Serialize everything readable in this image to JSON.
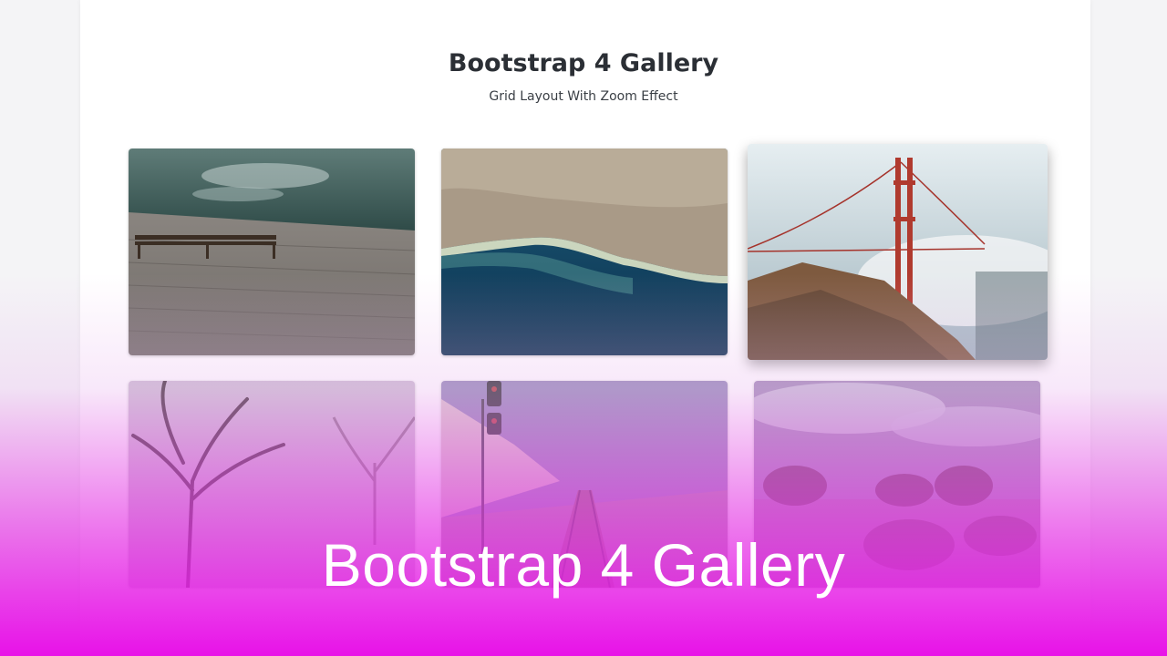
{
  "header": {
    "title": "Bootstrap 4 Gallery",
    "subtitle": "Grid Layout With Zoom Effect"
  },
  "gallery": {
    "images": [
      {
        "subject": "wooden-dock-bench",
        "zoomed": false
      },
      {
        "subject": "aerial-coastline",
        "zoomed": false
      },
      {
        "subject": "golden-gate-bridge-fog",
        "zoomed": true
      },
      {
        "subject": "misty-trees",
        "zoomed": false
      },
      {
        "subject": "railroad-tracks-signal",
        "zoomed": false
      },
      {
        "subject": "boulders-cloudy-sky",
        "zoomed": false
      }
    ]
  },
  "overlay": {
    "banner_text": "Bootstrap 4 Gallery",
    "gradient_color": "#e812e8"
  }
}
